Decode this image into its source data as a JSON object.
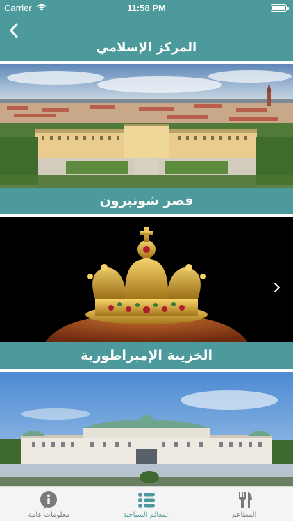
{
  "status_bar": {
    "carrier": "Carrier",
    "time": "11:58 PM"
  },
  "header": {
    "title": "المركز الإسلامي"
  },
  "attractions": [
    {
      "label": "قصر شونبرون"
    },
    {
      "label": "الخزينة الإمبراطورية"
    },
    {
      "label": ""
    }
  ],
  "tab_bar": {
    "items": [
      {
        "label": "معلومات عامة",
        "icon": "info-icon"
      },
      {
        "label": "المعالم السياحية",
        "icon": "list-icon",
        "active": true
      },
      {
        "label": "المطاعم",
        "icon": "fork-knife-icon"
      }
    ]
  },
  "colors": {
    "accent": "#4d9a9c",
    "tab_inactive": "#7a7a7a"
  }
}
